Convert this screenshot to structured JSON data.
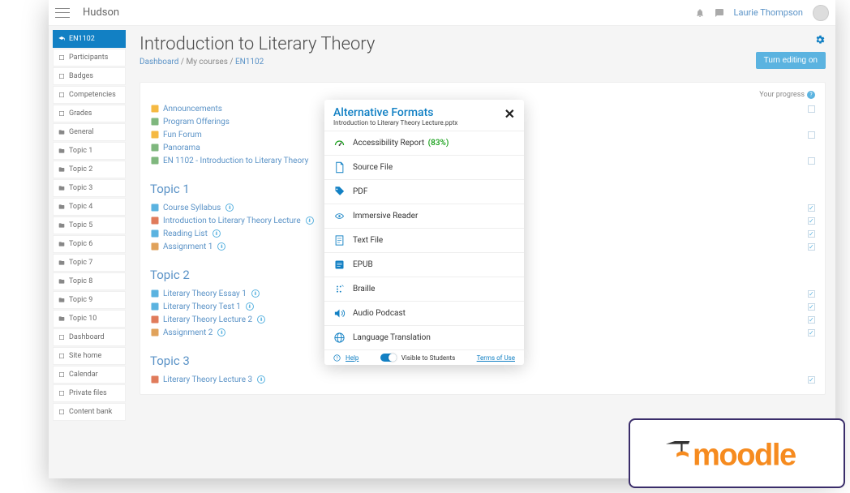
{
  "brand": "Hudson",
  "user": {
    "name": "Laurie Thompson"
  },
  "sidebar": {
    "active": "EN1102",
    "items": [
      {
        "label": "EN1102",
        "icon": "graduation-cap-icon"
      },
      {
        "label": "Participants",
        "icon": "users-icon"
      },
      {
        "label": "Badges",
        "icon": "shield-icon"
      },
      {
        "label": "Competencies",
        "icon": "check-icon"
      },
      {
        "label": "Grades",
        "icon": "grades-icon"
      },
      {
        "label": "General",
        "icon": "folder-icon"
      },
      {
        "label": "Topic 1",
        "icon": "folder-icon"
      },
      {
        "label": "Topic 2",
        "icon": "folder-icon"
      },
      {
        "label": "Topic 3",
        "icon": "folder-icon"
      },
      {
        "label": "Topic 4",
        "icon": "folder-icon"
      },
      {
        "label": "Topic 5",
        "icon": "folder-icon"
      },
      {
        "label": "Topic 6",
        "icon": "folder-icon"
      },
      {
        "label": "Topic 7",
        "icon": "folder-icon"
      },
      {
        "label": "Topic 8",
        "icon": "folder-icon"
      },
      {
        "label": "Topic 9",
        "icon": "folder-icon"
      },
      {
        "label": "Topic 10",
        "icon": "folder-icon"
      },
      {
        "label": "Dashboard",
        "icon": "tachometer-icon"
      },
      {
        "label": "Site home",
        "icon": "home-icon"
      },
      {
        "label": "Calendar",
        "icon": "calendar-icon"
      },
      {
        "label": "Private files",
        "icon": "file-icon"
      },
      {
        "label": "Content bank",
        "icon": "pencil-icon"
      }
    ]
  },
  "page": {
    "title": "Introduction to Literary Theory",
    "breadcrumb": {
      "root": "Dashboard",
      "mid": "My courses",
      "leaf": "EN1102"
    },
    "edit_button": "Turn editing on",
    "progress_label": "Your progress"
  },
  "sections": [
    {
      "title": "",
      "items": [
        {
          "label": "Announcements",
          "icon": "forum",
          "box": true
        },
        {
          "label": "Program Offerings",
          "icon": "book",
          "box": false
        },
        {
          "label": "Fun Forum",
          "icon": "forum",
          "box": true
        },
        {
          "label": "Panorama",
          "icon": "puzzle",
          "box": false
        },
        {
          "label": "EN 1102 - Introduction to Literary Theory",
          "icon": "book",
          "box": true
        }
      ]
    },
    {
      "title": "Topic 1",
      "items": [
        {
          "label": "Course Syllabus",
          "icon": "doc",
          "badge": true,
          "checked": true
        },
        {
          "label": "Introduction to Literary Theory Lecture",
          "icon": "ppt",
          "badge": true,
          "checked": true
        },
        {
          "label": "Reading List",
          "icon": "doc",
          "badge": true,
          "checked": true
        },
        {
          "label": "Assignment 1",
          "icon": "assign",
          "badge": true,
          "checked": true
        }
      ]
    },
    {
      "title": "Topic 2",
      "items": [
        {
          "label": "Literary Theory Essay 1",
          "icon": "doc",
          "badge": true,
          "checked": true
        },
        {
          "label": "Literary Theory Test 1",
          "icon": "doc",
          "badge": true,
          "checked": true
        },
        {
          "label": "Literary Theory Lecture 2",
          "icon": "ppt",
          "badge": true,
          "checked": true
        },
        {
          "label": "Assignment 2",
          "icon": "assign",
          "badge": true,
          "checked": true
        }
      ]
    },
    {
      "title": "Topic 3",
      "items": [
        {
          "label": "Literary Theory Lecture 3",
          "icon": "ppt",
          "badge": true,
          "checked": true
        }
      ]
    }
  ],
  "modal": {
    "title": "Alternative Formats",
    "subtitle": "Introduction to Literary Theory Lecture.pptx",
    "items": [
      {
        "label": "Accessibility Report",
        "pct": "(83%)",
        "icon": "gauge"
      },
      {
        "label": "Source File",
        "icon": "file"
      },
      {
        "label": "PDF",
        "icon": "tag"
      },
      {
        "label": "Immersive Reader",
        "icon": "reader"
      },
      {
        "label": "Text File",
        "icon": "textfile"
      },
      {
        "label": "EPUB",
        "icon": "epub"
      },
      {
        "label": "Braille",
        "icon": "braille"
      },
      {
        "label": "Audio Podcast",
        "icon": "audio"
      },
      {
        "label": "Language Translation",
        "icon": "globe"
      }
    ],
    "help": "Help",
    "visible": "Visible to Students",
    "terms": "Terms of Use"
  },
  "logo": "moodle"
}
